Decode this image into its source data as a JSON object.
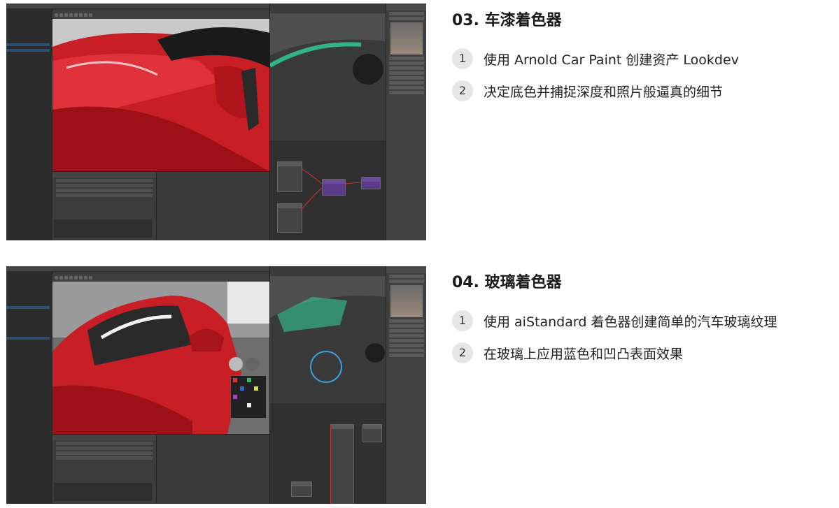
{
  "sections": [
    {
      "title": "03. 车漆着色器",
      "items": [
        {
          "num": "1",
          "text": "使用 Arnold Car Paint 创建资产 Lookdev"
        },
        {
          "num": "2",
          "text": "决定底色并捕捉深度和照片般逼真的细节"
        }
      ]
    },
    {
      "title": "04. 玻璃着色器",
      "items": [
        {
          "num": "1",
          "text": "使用 aiStandard 着色器创建简单的汽车玻璃纹理"
        },
        {
          "num": "2",
          "text": "在玻璃上应用蓝色和凹凸表面效果"
        }
      ]
    }
  ],
  "colors": {
    "car_red": "#c81e26",
    "maya_panel": "#3b3b3b",
    "wireframe_green": "#2fd49a",
    "shader_node_purple": "#6a4a9a",
    "badge_bg": "#e6e6e6"
  },
  "icons": [
    "window-thumbnail",
    "car-paint-render",
    "car-glass-render",
    "hypershade-node-graph"
  ]
}
